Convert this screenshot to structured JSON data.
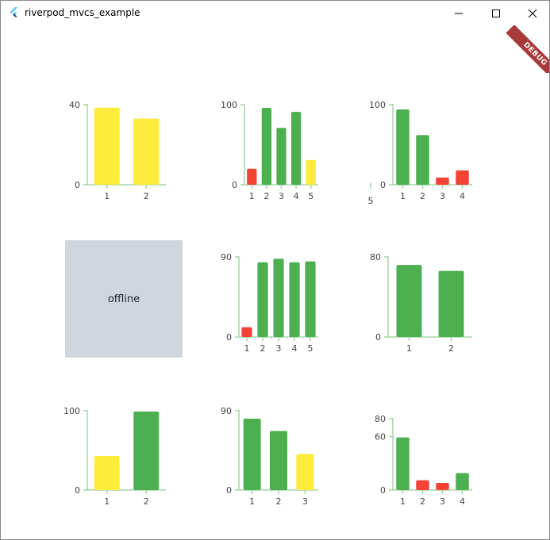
{
  "window": {
    "title": "riverpod_mvcs_example",
    "debug_label": "DEBUG"
  },
  "colors": {
    "green": "#4caf50",
    "yellow": "#ffeb3b",
    "red": "#f44336",
    "axis": "#a5d6a7",
    "offline_bg": "#d0d6dd"
  },
  "offline_label": "offline",
  "chart_data": [
    {
      "type": "bar",
      "ymax": 40,
      "yticks": [
        0,
        40
      ],
      "categories": [
        "1",
        "2"
      ],
      "values": [
        38.5,
        33
      ],
      "colors": [
        "yellow",
        "yellow"
      ]
    },
    {
      "type": "bar",
      "ymax": 100,
      "yticks": [
        0,
        100
      ],
      "categories": [
        "1",
        "2",
        "3",
        "4",
        "5"
      ],
      "values": [
        20,
        96,
        71,
        91,
        31
      ],
      "colors": [
        "red",
        "green",
        "green",
        "green",
        "yellow"
      ]
    },
    {
      "type": "bar",
      "ymax": 100,
      "yticks": [
        0,
        100
      ],
      "categories": [
        "1",
        "2",
        "3",
        "4"
      ],
      "values": [
        94,
        62,
        9,
        18
      ],
      "colors": [
        "green",
        "green",
        "red",
        "red"
      ],
      "stray_label": "5"
    },
    {
      "type": "offline"
    },
    {
      "type": "bar",
      "ymax": 90,
      "yticks": [
        0,
        90
      ],
      "categories": [
        "1",
        "2",
        "3",
        "4",
        "5"
      ],
      "values": [
        11,
        84,
        88,
        84,
        85
      ],
      "colors": [
        "red",
        "green",
        "green",
        "green",
        "green"
      ]
    },
    {
      "type": "bar",
      "ymax": 80,
      "yticks": [
        0,
        80
      ],
      "categories": [
        "1",
        "2"
      ],
      "values": [
        72,
        66
      ],
      "colors": [
        "green",
        "green"
      ]
    },
    {
      "type": "bar",
      "ymax": 100,
      "yticks": [
        0,
        100
      ],
      "categories": [
        "1",
        "2"
      ],
      "values": [
        43,
        99
      ],
      "colors": [
        "yellow",
        "green"
      ]
    },
    {
      "type": "bar",
      "ymax": 90,
      "yticks": [
        0,
        90
      ],
      "categories": [
        "1",
        "2",
        "3"
      ],
      "values": [
        81,
        67,
        41
      ],
      "colors": [
        "green",
        "green",
        "yellow"
      ]
    },
    {
      "type": "bar",
      "ymax": 80,
      "yticks": [
        0,
        60,
        80
      ],
      "categories": [
        "1",
        "2",
        "3",
        "4"
      ],
      "values": [
        59,
        11,
        8,
        19
      ],
      "colors": [
        "green",
        "red",
        "red",
        "green"
      ]
    }
  ]
}
